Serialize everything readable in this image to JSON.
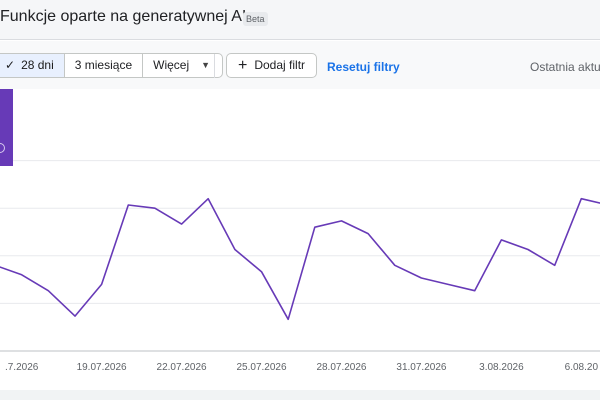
{
  "header": {
    "title": "Funkcje oparte na generatywnej AI",
    "badge": "Beta"
  },
  "toolbar": {
    "range_options": [
      {
        "label": "28 dni",
        "selected": true
      },
      {
        "label": "3 miesiące",
        "selected": false
      },
      {
        "label": "Więcej",
        "selected": false
      }
    ],
    "add_filter_label": "Dodaj filtr",
    "reset_label": "Resetuj filtry",
    "last_updated_label": "Ostatnia aktua"
  },
  "colors": {
    "series": "#673ab7",
    "link": "#1a73e8"
  },
  "chart_data": {
    "type": "line",
    "x_tick_labels": [
      ".7.2026",
      "19.07.2026",
      "22.07.2026",
      "25.07.2026",
      "28.07.2026",
      "31.07.2026",
      "3.08.2026",
      "6.08.20"
    ],
    "series": [
      {
        "values": [
          52,
          49,
          44,
          36,
          46,
          71,
          70,
          65,
          73,
          57,
          50,
          35,
          64,
          66,
          62,
          52,
          48,
          46,
          44,
          60,
          57,
          52,
          73,
          71
        ]
      }
    ],
    "ylim": [
      25,
      100
    ],
    "grid": true
  }
}
